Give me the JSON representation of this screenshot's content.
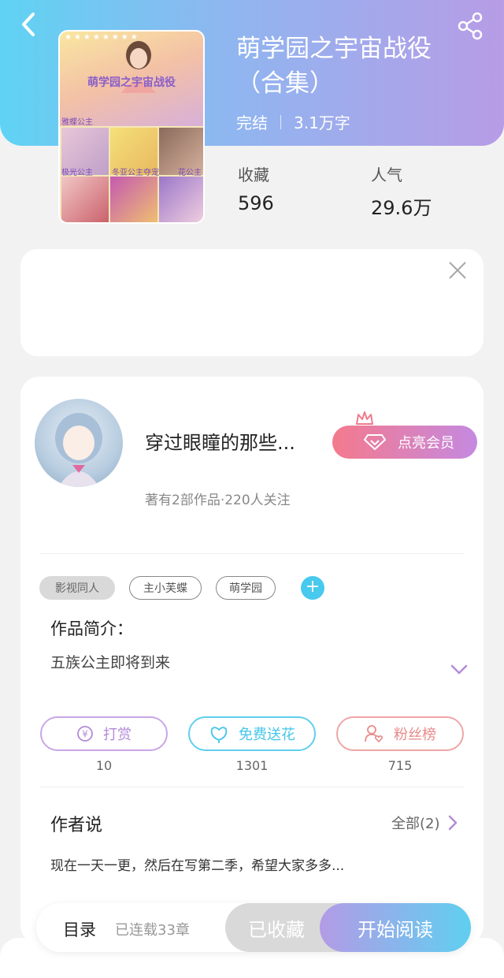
{
  "header": {
    "book_title": "萌学园之宇宙战役（合集）",
    "status": "完结",
    "word_count": "3.1万字",
    "stats": [
      {
        "label": "收藏",
        "value": "596"
      },
      {
        "label": "人气",
        "value": "29.6万"
      }
    ],
    "colors": {
      "gradient_start": "#5fd3f3",
      "gradient_end": "#b79ce6"
    }
  },
  "cover": {
    "title": "萌学园之宇宙战役",
    "captions": [
      "雅蝶公主",
      "极光公主",
      "冬亚公主夺宠",
      "花公主"
    ]
  },
  "author": {
    "name": "穿过眼瞳的那些...",
    "meta": "著有2部作品·220人关注",
    "vip_button": "点亮会员"
  },
  "tags": [
    {
      "label": "影视同人",
      "style": "filled"
    },
    {
      "label": "主小芙蝶",
      "style": "outline"
    },
    {
      "label": "萌学园",
      "style": "outline"
    }
  ],
  "intro": {
    "title": "作品简介：",
    "text": "五族公主即将到来"
  },
  "actions": [
    {
      "label": "打赏",
      "count": "10",
      "color": "#b48bd8"
    },
    {
      "label": "免费送花",
      "count": "1301",
      "color": "#46c6e8"
    },
    {
      "label": "粉丝榜",
      "count": "715",
      "color": "#e98a8a"
    }
  ],
  "author_says": {
    "title": "作者说",
    "all_label": "全部(2)",
    "text": "现在一天一更，然后在写第二季，希望大家多多..."
  },
  "bottom": {
    "toc": "目录",
    "chapters": "已连载33章",
    "favorited": "已收藏",
    "start_reading": "开始阅读"
  }
}
